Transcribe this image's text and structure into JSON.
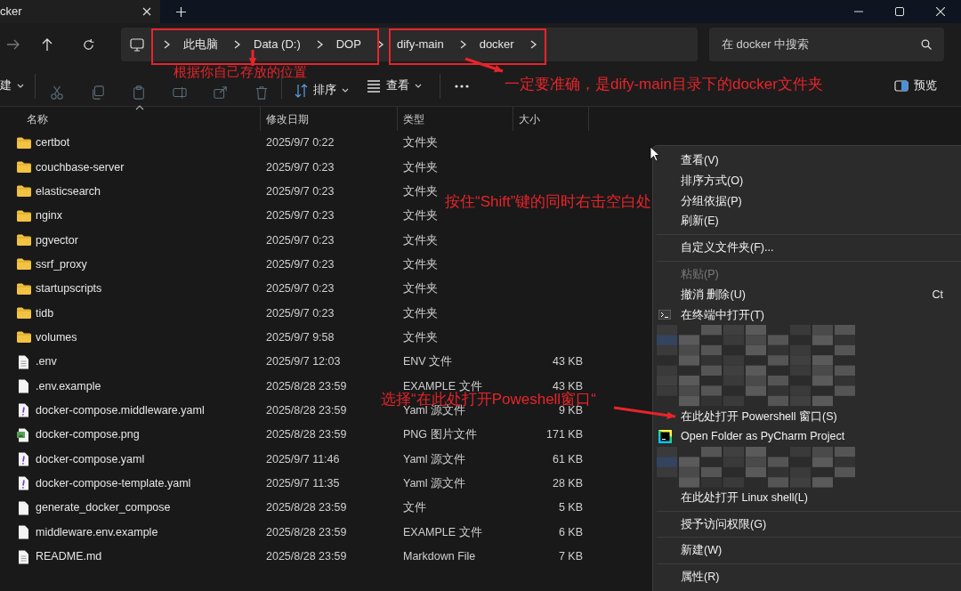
{
  "tab": {
    "title": "cker"
  },
  "address": {
    "crumbs": [
      "此电脑",
      "Data (D:)",
      "DOP",
      "dify-main",
      "docker"
    ],
    "search": {
      "placeholder": "在 docker 中搜索"
    }
  },
  "toolbar": {
    "new_label": "建",
    "actions": [
      {
        "kind": "cut",
        "disabled": true
      },
      {
        "kind": "copy",
        "disabled": true
      },
      {
        "kind": "paste",
        "disabled": true
      },
      {
        "kind": "rename",
        "disabled": true
      },
      {
        "kind": "share",
        "disabled": true
      },
      {
        "kind": "delete",
        "disabled": true
      }
    ],
    "sort_label": "排序",
    "view_label": "查看",
    "preview_label": "预览"
  },
  "columns": [
    "名称",
    "修改日期",
    "类型",
    "大小"
  ],
  "files": [
    {
      "kind": "folder",
      "name": "certbot",
      "modified": "2025/9/7 0:22",
      "type": "文件夹"
    },
    {
      "kind": "folder",
      "name": "couchbase-server",
      "modified": "2025/9/7 0:23",
      "type": "文件夹"
    },
    {
      "kind": "folder",
      "name": "elasticsearch",
      "modified": "2025/9/7 0:23",
      "type": "文件夹"
    },
    {
      "kind": "folder",
      "name": "nginx",
      "modified": "2025/9/7 0:23",
      "type": "文件夹"
    },
    {
      "kind": "folder",
      "name": "pgvector",
      "modified": "2025/9/7 0:23",
      "type": "文件夹"
    },
    {
      "kind": "folder",
      "name": "ssrf_proxy",
      "modified": "2025/9/7 0:23",
      "type": "文件夹"
    },
    {
      "kind": "folder",
      "name": "startupscripts",
      "modified": "2025/9/7 0:23",
      "type": "文件夹"
    },
    {
      "kind": "folder",
      "name": "tidb",
      "modified": "2025/9/7 0:23",
      "type": "文件夹"
    },
    {
      "kind": "folder",
      "name": "volumes",
      "modified": "2025/9/7 9:58",
      "type": "文件夹"
    },
    {
      "kind": "text",
      "name": ".env",
      "modified": "2025/9/7 12:03",
      "type": "ENV 文件",
      "size": "43 KB"
    },
    {
      "kind": "file",
      "name": ".env.example",
      "modified": "2025/8/28 23:59",
      "type": "EXAMPLE 文件",
      "size": "43 KB"
    },
    {
      "kind": "yaml",
      "name": "docker-compose.middleware.yaml",
      "modified": "2025/8/28 23:59",
      "type": "Yaml 源文件",
      "size": "9 KB"
    },
    {
      "kind": "image",
      "name": "docker-compose.png",
      "modified": "2025/8/28 23:59",
      "type": "PNG 图片文件",
      "size": "171 KB"
    },
    {
      "kind": "yaml",
      "name": "docker-compose.yaml",
      "modified": "2025/9/7 11:46",
      "type": "Yaml 源文件",
      "size": "61 KB"
    },
    {
      "kind": "yaml",
      "name": "docker-compose-template.yaml",
      "modified": "2025/9/7 11:35",
      "type": "Yaml 源文件",
      "size": "28 KB"
    },
    {
      "kind": "file",
      "name": "generate_docker_compose",
      "modified": "2025/8/28 23:59",
      "type": "文件",
      "size": "5 KB"
    },
    {
      "kind": "file",
      "name": "middleware.env.example",
      "modified": "2025/8/28 23:59",
      "type": "EXAMPLE 文件",
      "size": "6 KB"
    },
    {
      "kind": "text",
      "name": "README.md",
      "modified": "2025/8/28 23:59",
      "type": "Markdown File",
      "size": "7 KB"
    }
  ],
  "context_menu": [
    {
      "kind": "item",
      "label": "查看(V)",
      "disabled": false
    },
    {
      "kind": "item",
      "label": "排序方式(O)",
      "disabled": false
    },
    {
      "kind": "item",
      "label": "分组依据(P)",
      "disabled": false
    },
    {
      "kind": "item",
      "label": "刷新(E)",
      "disabled": false
    },
    {
      "kind": "separator"
    },
    {
      "kind": "item",
      "label": "自定义文件夹(F)...",
      "disabled": false
    },
    {
      "kind": "separator"
    },
    {
      "kind": "item",
      "label": "粘贴(P)",
      "disabled": true
    },
    {
      "kind": "item",
      "label": "撤消 删除(U)",
      "disabled": false,
      "shortcut": "Ct"
    },
    {
      "kind": "terminal",
      "label": "在终端中打开(T)",
      "disabled": false
    },
    {
      "kind": "redacted"
    },
    {
      "kind": "item",
      "label": "在此处打开 Powershell 窗口(S)",
      "disabled": false
    },
    {
      "kind": "pycharm",
      "label": "Open Folder as PyCharm Project",
      "disabled": false
    },
    {
      "kind": "redacted"
    },
    {
      "kind": "item",
      "label": "在此处打开 Linux shell(L)",
      "disabled": false
    },
    {
      "kind": "separator"
    },
    {
      "kind": "item",
      "label": "授予访问权限(G)",
      "disabled": false
    },
    {
      "kind": "separator"
    },
    {
      "kind": "item",
      "label": "新建(W)",
      "disabled": false
    },
    {
      "kind": "separator"
    },
    {
      "kind": "item",
      "label": "属性(R)",
      "disabled": false
    }
  ],
  "annotations": [
    "根据你自己存放的位置",
    "一定要准确，是dify-main目录下的docker文件夹",
    "按住“Shift”键的同时右击空白处",
    "选择“在此处打开Poweshell窗口“"
  ]
}
